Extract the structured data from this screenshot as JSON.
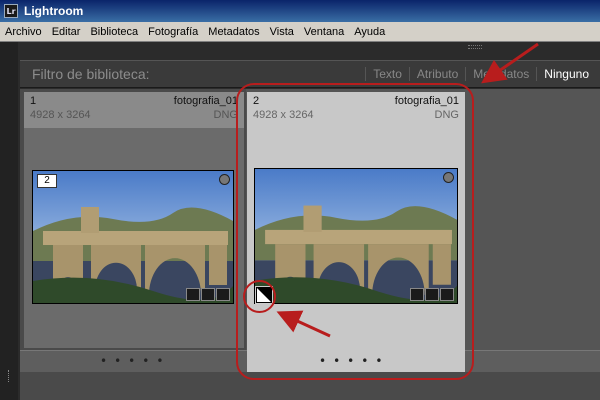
{
  "window": {
    "app_icon": "Lr",
    "title": "Lightroom"
  },
  "menu": [
    "Archivo",
    "Editar",
    "Biblioteca",
    "Fotografía",
    "Metadatos",
    "Vista",
    "Ventana",
    "Ayuda"
  ],
  "filter": {
    "title": "Filtro de biblioteca:",
    "options": [
      "Texto",
      "Atributo",
      "Metadatos",
      "Ninguno"
    ],
    "active": "Ninguno"
  },
  "cells": [
    {
      "index": "1",
      "filename": "fotografia_01",
      "dimensions": "4928 x 3264",
      "filetype": "DNG",
      "badge": "2"
    },
    {
      "index": "2",
      "filename": "fotografia_01",
      "dimensions": "4928 x 3264",
      "filetype": "DNG"
    }
  ],
  "icons": {
    "app": "lightroom-logo",
    "thumb_badges": [
      "collection-icon",
      "edit-tag-icon",
      "crop-icon"
    ],
    "flag": "corner-flag-icon",
    "pick": "circle-pick-icon"
  },
  "colors": {
    "annotation": "#b81d1d",
    "selected_cell": "#c8c8c8",
    "titlebar": "#0a246a"
  }
}
